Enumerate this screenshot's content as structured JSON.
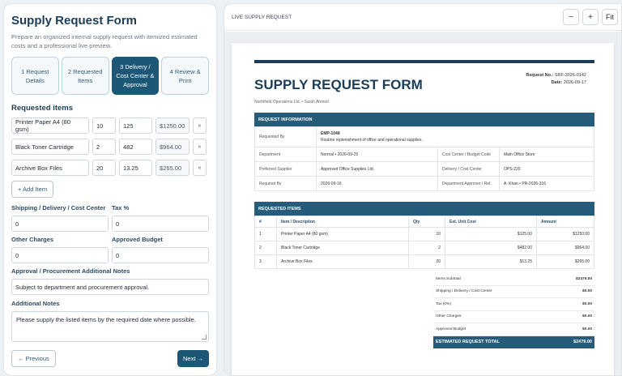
{
  "form": {
    "title": "Supply Request Form",
    "description": "Prepare an organized internal supply request with itemized estimated costs and a professional live preview.",
    "steps": [
      "1 Request Details",
      "2 Requested Items",
      "3 Delivery / Cost Center & Approval",
      "4 Review & Print"
    ],
    "items_heading": "Requested items",
    "items": [
      {
        "name": "Printer Paper A4 (80 gsm)",
        "qty": "10",
        "cost": "125",
        "total": "$1250.00"
      },
      {
        "name": "Black Toner Cartridge",
        "qty": "2",
        "cost": "482",
        "total": "$964.00"
      },
      {
        "name": "Archive Box Files",
        "qty": "20",
        "cost": "13.25",
        "total": "$265.00"
      }
    ],
    "remove_glyph": "«",
    "add_item": "+ Add Item",
    "shipping_label": "Shipping / Delivery / Cost Center",
    "shipping_value": "0",
    "tax_label": "Tax %",
    "tax_value": "0",
    "other_label": "Other Charges",
    "other_value": "0",
    "budget_label": "Approved Budget",
    "budget_value": "0",
    "approval_label": "Approval / Procurement Additional Notes",
    "approval_value": "Subject to department and procurement approval.",
    "notes_label": "Additional Notes",
    "notes_value": "Please supply the listed items by the required date where possible.",
    "prev": "← Previous",
    "next": "Next →"
  },
  "preview": {
    "label": "LIVE SUPPLY REQUEST",
    "zoom_out": "−",
    "zoom_in": "+",
    "fit": "Fit",
    "doc_title": "SUPPLY REQUEST FORM",
    "req_no_label": "Request No.:",
    "req_no": "SRF-2026-0142",
    "date_label": "Date:",
    "date": "2026-09-17",
    "subtitle": "Northfield Operations Ltd. • Sarah Ahmed",
    "info_heading": "REQUEST INFORMATION",
    "requested_by_label": "Requested By",
    "requested_by_id": "EMP-1048",
    "requested_by_note": "Routine replenishment of office and operational supplies.",
    "department_label": "Department",
    "department": "Normal • 2026-09-25",
    "cost_center_label": "Cost Center / Budget Code",
    "cost_center": "Main Office Store",
    "supplier_label": "Preferred Supplier",
    "supplier": "Approved Office Supplies Ltd.",
    "delivery_label": "Delivery / Cost Center",
    "delivery": "OPS-220",
    "required_label": "Required By",
    "required": "2026-09-16",
    "approver_label": "Department Approver / Ref.",
    "approver": "A. Khan • PR-2026-316",
    "items_heading": "REQUESTED ITEMS",
    "cols": [
      "#",
      "Item / Description",
      "Qty",
      "Est. Unit Cost",
      "Amount"
    ],
    "rows": [
      [
        "1",
        "Printer Paper A4 (80 gsm)",
        "10",
        "$125.00",
        "$1250.00"
      ],
      [
        "2",
        "Black Toner Cartridge",
        "2",
        "$482.00",
        "$964.00"
      ],
      [
        "3",
        "Archive Box Files",
        "20",
        "$13.25",
        "$265.00"
      ]
    ],
    "totals": [
      [
        "Items Subtotal",
        "$2479.00"
      ],
      [
        "Shipping / Delivery / Cost Center",
        "$0.00"
      ],
      [
        "Tax (0%)",
        "$0.00"
      ],
      [
        "Other Charges",
        "$0.00"
      ],
      [
        "Approved Budget",
        "$0.00"
      ]
    ],
    "grand_label": "ESTIMATED REQUEST TOTAL",
    "grand_value": "$2479.00"
  }
}
